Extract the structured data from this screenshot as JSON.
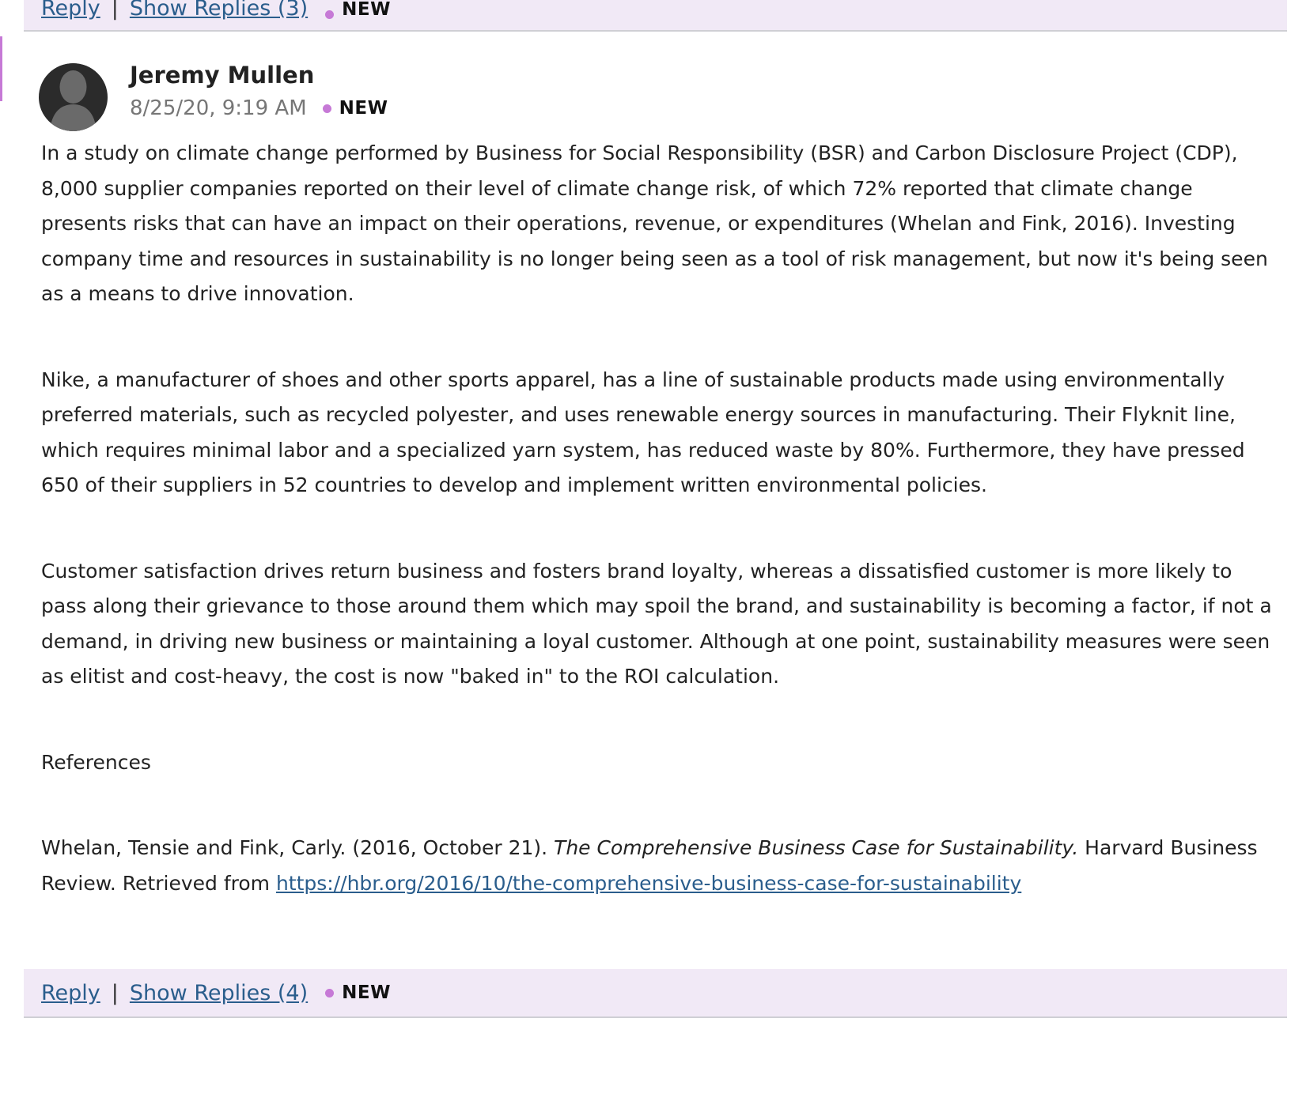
{
  "previous_post": {
    "reply_label": "Reply",
    "separator": "|",
    "show_replies_label": "Show Replies (3)",
    "new_badge": "NEW"
  },
  "post": {
    "author": "Jeremy Mullen",
    "timestamp": "8/25/20, 9:19 AM",
    "new_badge": "NEW",
    "paragraphs": [
      "In a study on climate change performed by Business for Social Responsibility (BSR) and Carbon Disclosure Project (CDP), 8,000 supplier companies reported on their level of climate change risk, of which 72% reported that climate change presents risks that can have an impact on their operations, revenue, or expenditures (Whelan and Fink, 2016). Investing company time and resources in sustainability is no longer being seen as a tool of risk management, but now it's being seen as a means to drive innovation.",
      "Nike, a manufacturer of shoes and other sports apparel, has a line of sustainable products made using environmentally preferred materials, such as recycled polyester, and uses renewable energy sources in manufacturing. Their Flyknit line, which requires minimal labor and a specialized yarn system, has reduced waste by 80%. Furthermore, they have pressed 650 of their suppliers in 52 countries to develop and implement written environmental policies.",
      "Customer satisfaction drives return business and fosters brand loyalty, whereas a dissatisfied customer is more likely to pass along their grievance to those around them which may spoil the brand, and sustainability is becoming a factor, if not a demand, in driving new business or maintaining a loyal customer. Although at one point, sustainability measures were seen as elitist and cost-heavy, the cost is now \"baked in\" to the ROI calculation."
    ],
    "references_heading": "References",
    "reference": {
      "prefix": "Whelan, Tensie and Fink, Carly. (2016, October 21). ",
      "title": "The Comprehensive Business Case for Sustainability.",
      "suffix": " Harvard Business Review. Retrieved from ",
      "link": "https://hbr.org/2016/10/the-comprehensive-business-case-for-sustainability"
    },
    "footer": {
      "reply_label": "Reply",
      "separator": "|",
      "show_replies_label": "Show Replies (4)",
      "new_badge": "NEW"
    }
  },
  "colors": {
    "footer_bg": "#f1e9f6",
    "new_dot": "#c679d6",
    "link": "#2a5d8c"
  }
}
